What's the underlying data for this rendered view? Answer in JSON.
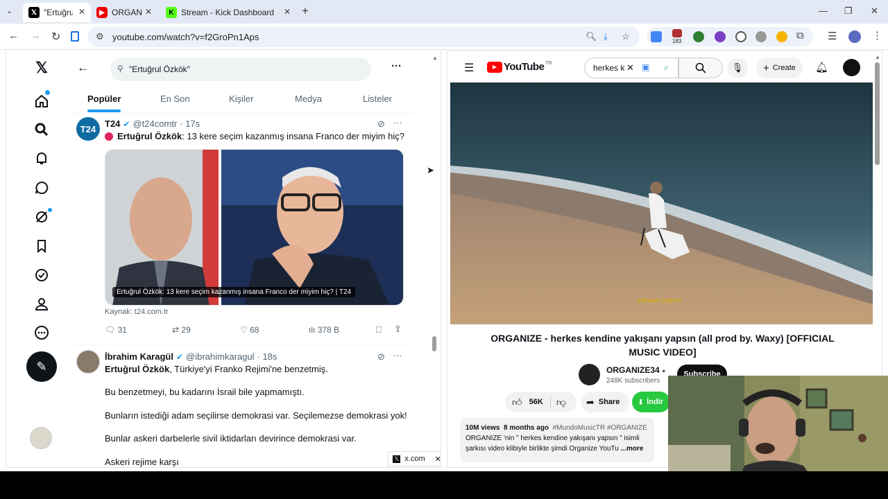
{
  "browser": {
    "tabs": [
      {
        "title": "\"Ertuğrul",
        "icon": "X"
      },
      {
        "title": "ORGANIZ",
        "icon": "yt"
      },
      {
        "title": "Stream - Kick Dashboard",
        "icon": "K"
      }
    ],
    "new_tab": "+",
    "url": "youtube.com/watch?v=f2GroPn1Aps",
    "ext_badge": "183"
  },
  "x": {
    "search_query": "\"Ertuğrul Özkök\"",
    "tabs": [
      "Popüler",
      "En Son",
      "Kişiler",
      "Medya",
      "Listeler"
    ],
    "tweets": [
      {
        "name": "T24",
        "handle": "@t24comtr",
        "time": "· 17s",
        "avatar": "T24",
        "text_bold": "Ertuğrul Özkök",
        "text": ": 13 kere seçim kazanmış insana Franco der miyim hiç?",
        "card_caption": "Ertuğrul Özkök: 13 kere seçim kazanmış insana Franco der miyim hiç? | T24",
        "source": "Kaynak: t24.com.tr",
        "replies": "31",
        "retweets": "29",
        "likes": "68",
        "views": "378 B"
      },
      {
        "name": "İbrahim Karagül",
        "handle": "@ibrahimkaragul",
        "time": "· 18s",
        "text_bold": "Ertuğrul Özkök",
        "text": ", Türkiye'yi Franko Rejimi'ne benzetmiş.",
        "lines": [
          "Bu benzetmeyi, bu kadarını İsrail bile yapmamıştı.",
          "Bunların istediği adam seçilirse demokrasi var. Seçilemezse demokrasi yok!",
          "Bunlar askeri darbelerle sivil iktidarları devirince demokrasi var.",
          "Askeri rejime karşı"
        ]
      }
    ],
    "popup": "x.com"
  },
  "youtube": {
    "logo": "YouTube",
    "region": "TR",
    "search_value": "herkes k",
    "create": "Create",
    "video_subtitle": "yakışanı yapsın",
    "title": "ORGANIZE - herkes kendine yakışanı yapsın (all prod by. Waxy) [OFFICIAL MUSIC VIDEO]",
    "channel": "ORGANIZE34",
    "subscribers": "248K subscribers",
    "subscribe": "Subscribe",
    "likes": "56K",
    "share": "Share",
    "download": "İndir",
    "desc_views": "10M views",
    "desc_age": "8 months ago",
    "desc_tags": "#MundoMusicTR #ORGANIZE",
    "desc_line1": "ORGANIZE 'nin \" herkes kendine yakışanı yapsın \" isimli",
    "desc_line2": "şarkısı video klibiyle birlikte şimdi Organize YouTu",
    "more": "...more"
  }
}
